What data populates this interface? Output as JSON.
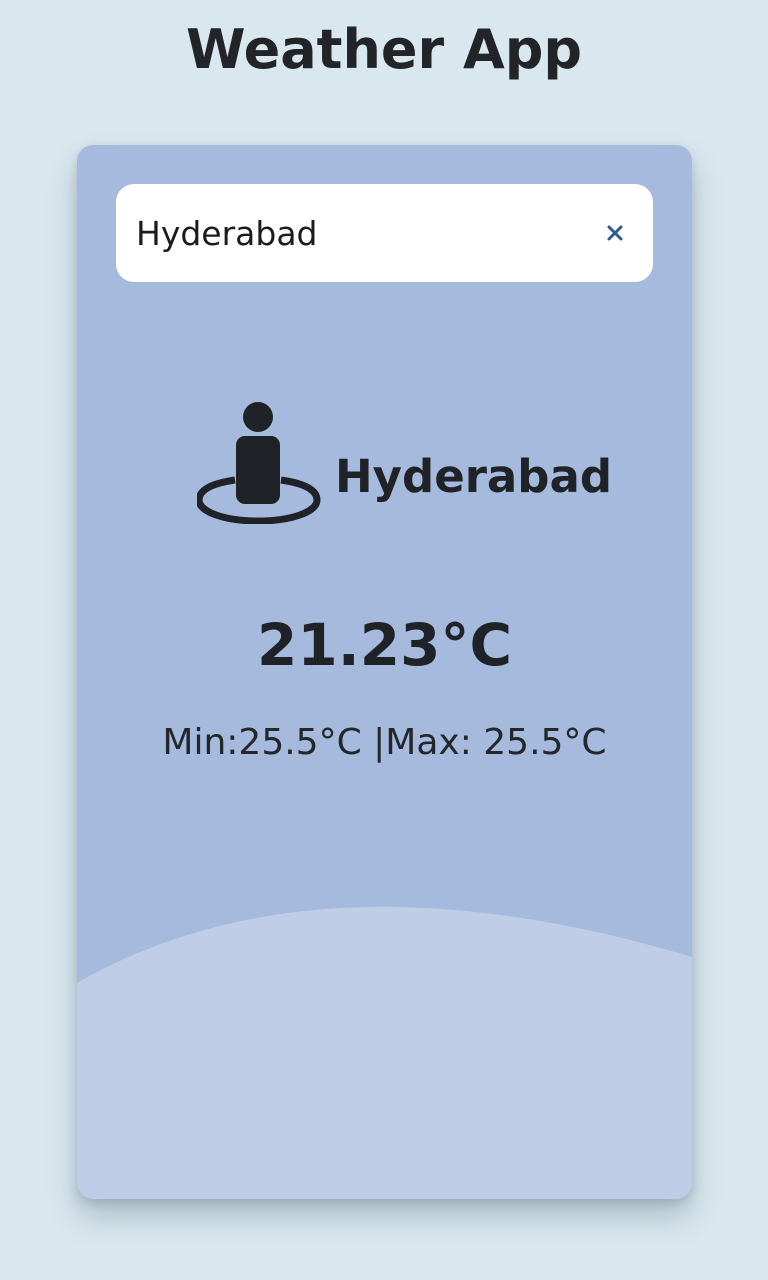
{
  "app": {
    "title": "Weather App"
  },
  "search": {
    "value": "Hyderabad",
    "placeholder": "",
    "clear_icon": "close-icon"
  },
  "weather": {
    "location_icon": "person-location-icon",
    "city": "Hyderabad",
    "temperature": "21.23°C",
    "min_max": "Min:25.5°C |Max: 25.5°C"
  },
  "colors": {
    "page_background": "#d9e8ef",
    "card_background": "#a5badd",
    "wave_fill": "#bfcde7",
    "clear_icon": "#2f5a8a"
  }
}
